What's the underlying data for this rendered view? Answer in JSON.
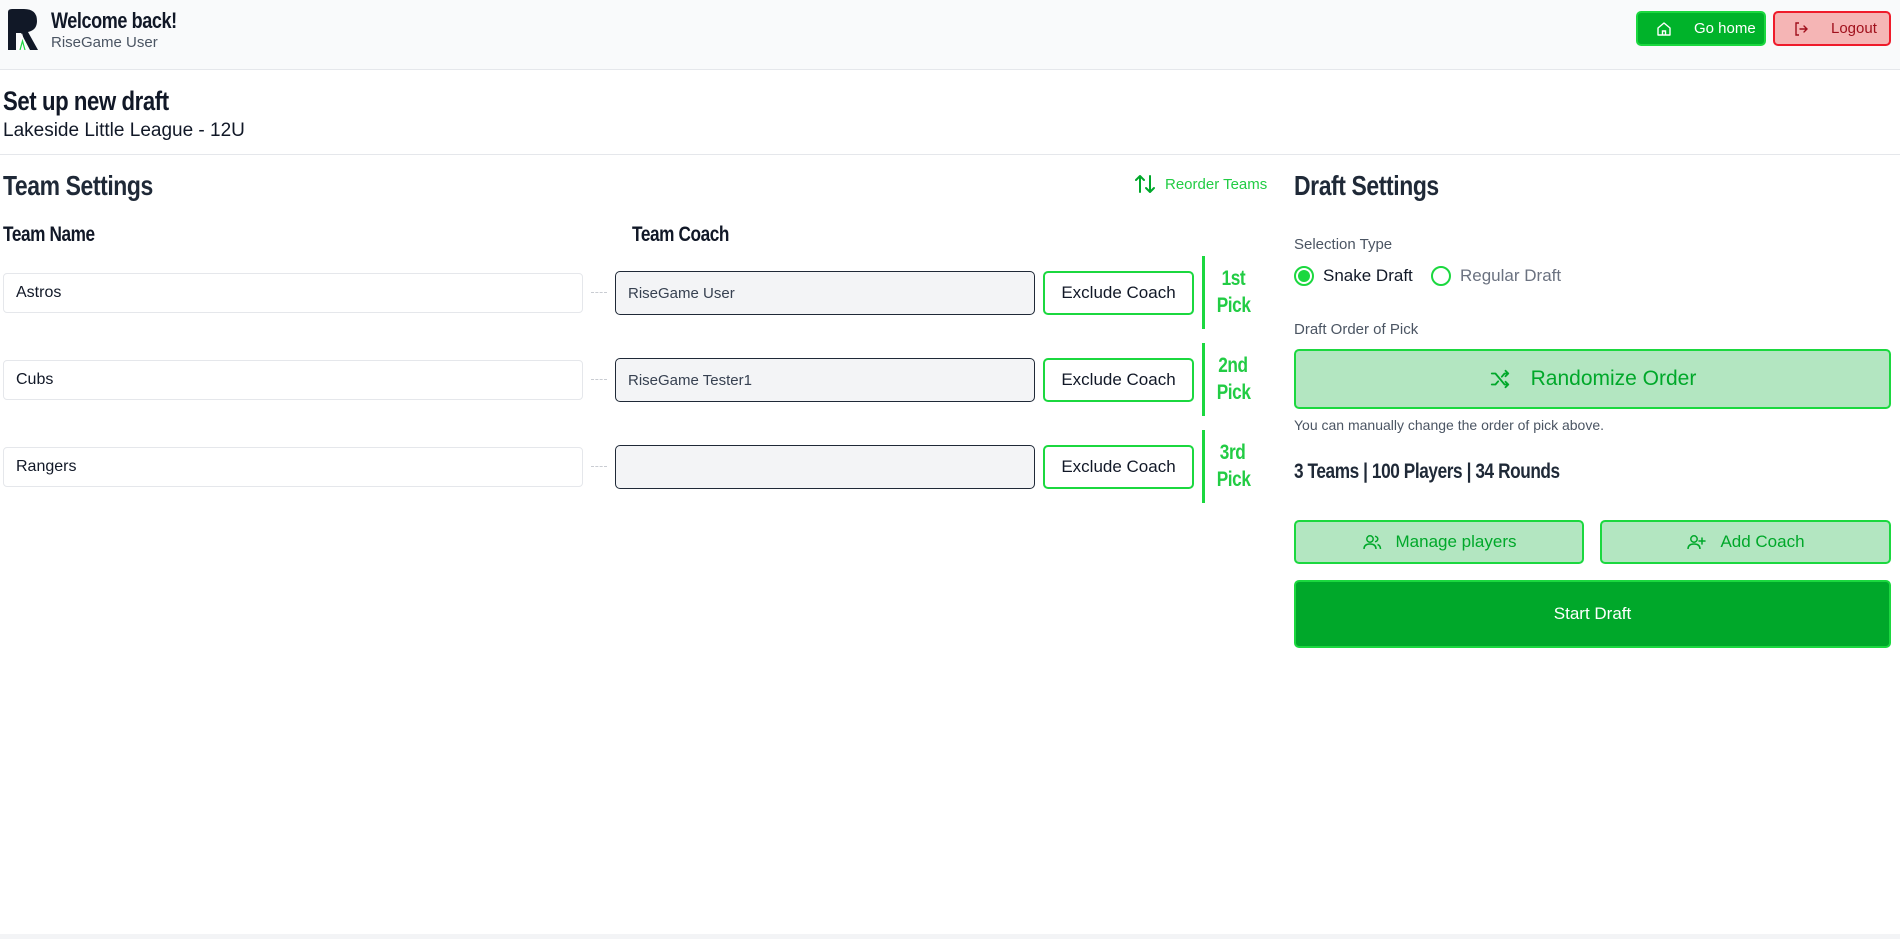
{
  "header": {
    "welcome": "Welcome back!",
    "user": "RiseGame User",
    "go_home": "Go home",
    "logout": "Logout"
  },
  "page": {
    "title": "Set up new draft",
    "subtitle": "Lakeside Little League - 12U"
  },
  "team_settings": {
    "title": "Team Settings",
    "reorder": "Reorder Teams",
    "col_team": "Team Name",
    "col_coach": "Team Coach",
    "rows": [
      {
        "team": "Astros",
        "coach": "RiseGame User",
        "exclude": "Exclude Coach",
        "pick_num": "1st",
        "pick_word": "Pick"
      },
      {
        "team": "Cubs",
        "coach": "RiseGame Tester1",
        "exclude": "Exclude Coach",
        "pick_num": "2nd",
        "pick_word": "Pick"
      },
      {
        "team": "Rangers",
        "coach": "",
        "exclude": "Exclude Coach",
        "pick_num": "3rd",
        "pick_word": "Pick"
      }
    ]
  },
  "draft_settings": {
    "title": "Draft Settings",
    "selection_type_label": "Selection Type",
    "options": [
      "Snake Draft",
      "Regular Draft"
    ],
    "selected_option": "Snake Draft",
    "order_label": "Draft Order of Pick",
    "randomize": "Randomize Order",
    "hint": "You can manually change the order of pick above.",
    "summary": "3 Teams | 100 Players | 34 Rounds",
    "manage_players": "Manage players",
    "add_coach": "Add Coach",
    "start_draft": "Start Draft"
  },
  "colors": {
    "accent": "#1bd83f",
    "primary": "#00a82a",
    "danger": "#ef1b2b"
  }
}
